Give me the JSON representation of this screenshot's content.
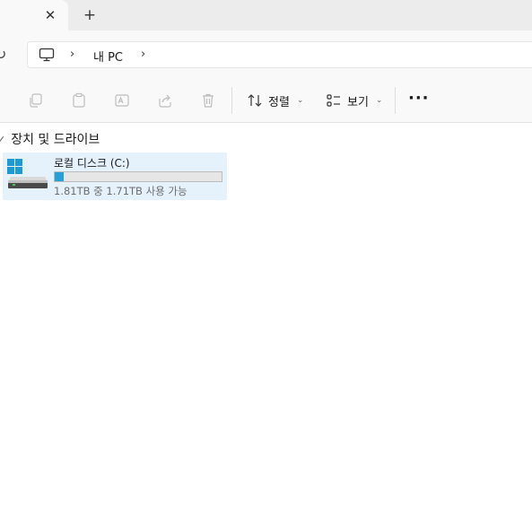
{
  "tabs": {
    "close_glyph": "✕",
    "new_tab_glyph": "+"
  },
  "address": {
    "refresh_glyph": "↻",
    "chevron_glyph": "›",
    "crumbs": [
      "내 PC"
    ]
  },
  "commands": {
    "sort_label": "정렬",
    "view_label": "보기",
    "dropdown_glyph": "⌄",
    "more_glyph": "···",
    "icons": [
      "copy-icon",
      "paste-icon",
      "rename-icon",
      "share-icon",
      "delete-icon",
      "sort-icon",
      "view-icon"
    ]
  },
  "section": {
    "collapse_glyph": "✓",
    "label": "장치 및 드라이브"
  },
  "drive": {
    "name": "로컬 디스크 (C:)",
    "space_text": "1.81TB 중 1.71TB 사용 가능",
    "used_fraction": 0.055,
    "bar_color": "#26a0da"
  }
}
